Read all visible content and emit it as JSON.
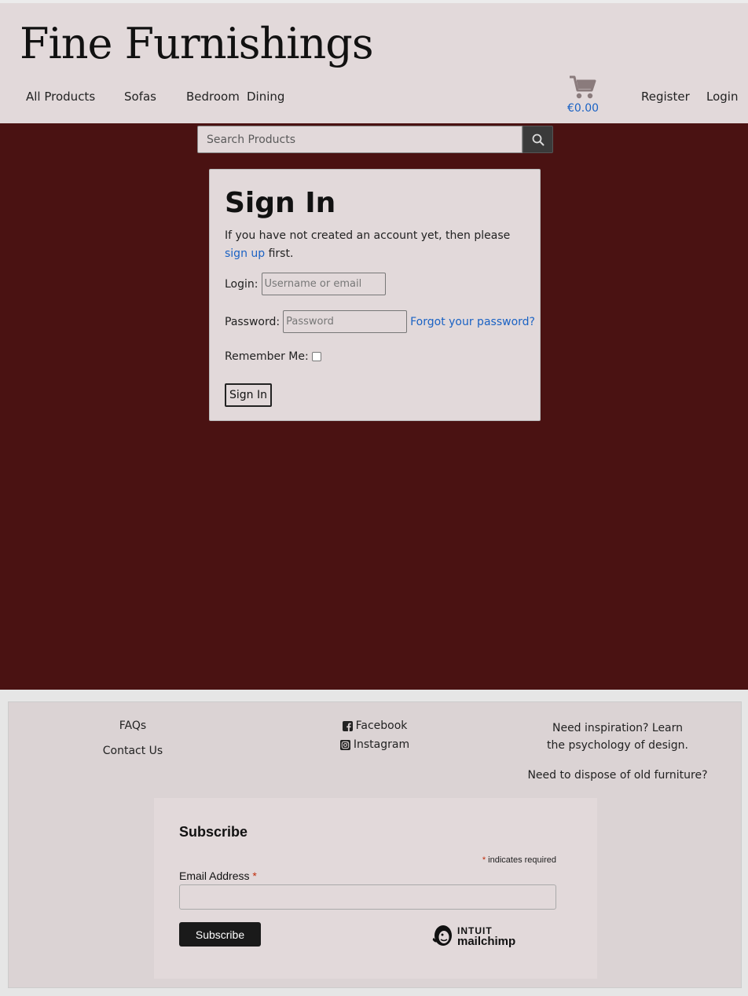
{
  "header": {
    "brand": "Fine Furnishings",
    "nav": [
      {
        "label": "All Products"
      },
      {
        "label": "Sofas"
      },
      {
        "label": "Bedroom"
      },
      {
        "label": "Dining"
      }
    ],
    "cart": {
      "icon": "shopping-cart-icon",
      "total": "€0.00"
    },
    "account": {
      "register": "Register",
      "login": "Login"
    }
  },
  "search": {
    "placeholder": "Search Products",
    "icon": "search-icon"
  },
  "signin": {
    "title": "Sign In",
    "intro_before": "If you have not created an account yet, then please ",
    "intro_link": "sign up",
    "intro_after": " first.",
    "login_label": "Login:",
    "login_placeholder": "Username or email",
    "password_label": "Password:",
    "password_placeholder": "Password",
    "forgot_link": "Forgot your password?",
    "remember_label": "Remember Me:",
    "remember_checked": false,
    "submit_label": "Sign In"
  },
  "footer": {
    "col1": {
      "faqs": "FAQs",
      "contact": "Contact Us"
    },
    "col2": {
      "facebook": "Facebook",
      "instagram": "Instagram"
    },
    "col3": {
      "inspiration": "Need inspiration? Learn the psychology of design.",
      "dispose": "Need to dispose of old furniture?"
    }
  },
  "subscribe": {
    "title": "Subscribe",
    "required_marker": "*",
    "required_note": " indicates required",
    "email_label": "Email Address",
    "button_label": "Subscribe",
    "logo_line1": "INTUIT",
    "logo_line2": "mailchimp"
  },
  "colors": {
    "header_bg": "#e2d9da",
    "main_bg": "#4a1212",
    "link": "#1a62c4",
    "cart_icon": "#8a7b7c",
    "required": "#c02b0a"
  }
}
